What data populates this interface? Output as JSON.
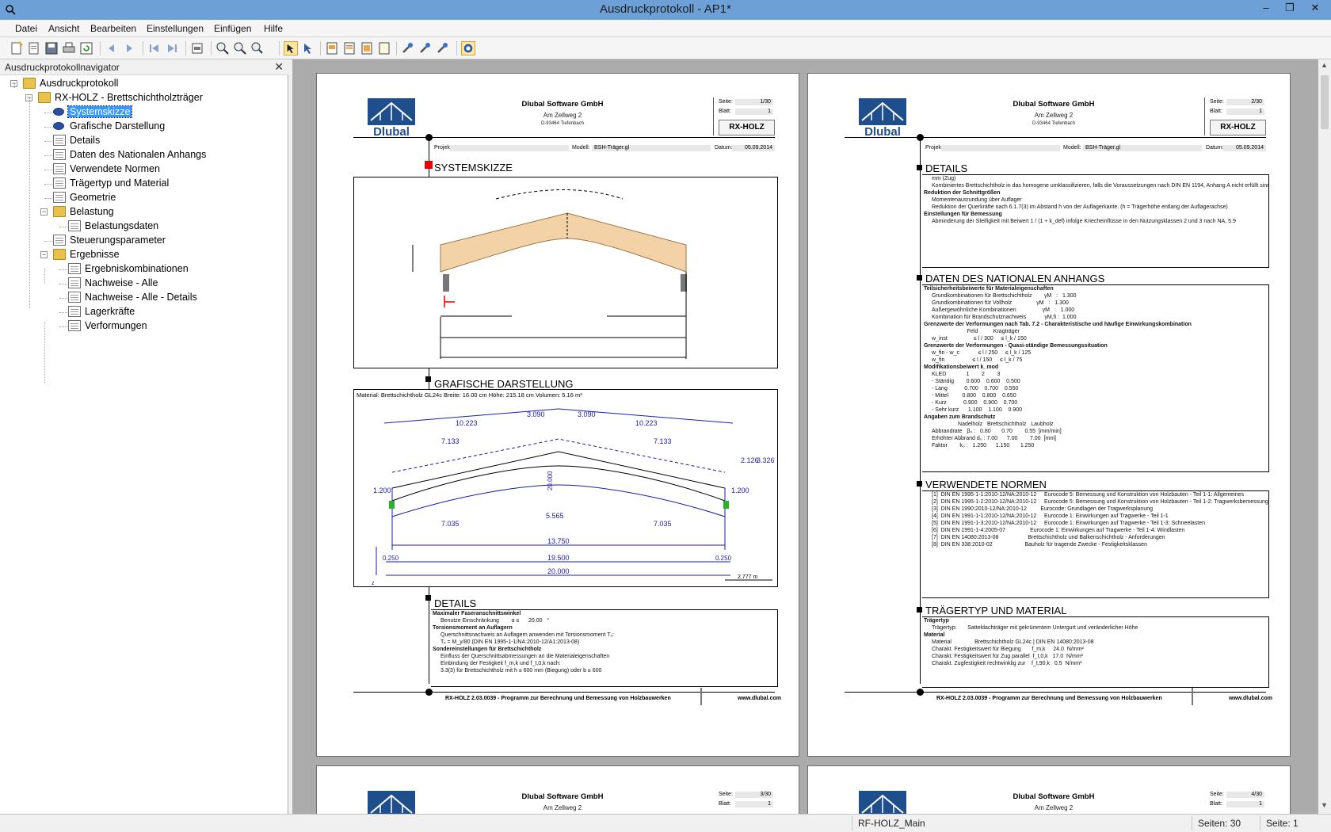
{
  "window": {
    "title": "Ausdruckprotokoll - AP1*",
    "controls": [
      "–",
      "❐",
      "✕"
    ]
  },
  "menu": [
    "Datei",
    "Ansicht",
    "Bearbeiten",
    "Einstellungen",
    "Einfügen",
    "Hilfe"
  ],
  "navigator": {
    "title": "Ausdruckprotokollnavigator",
    "tree": [
      {
        "label": "Ausdruckprotokoll",
        "level": 0,
        "icon": "folder",
        "exp": "-"
      },
      {
        "label": "RX-HOLZ - Brettschichtholzträger",
        "level": 1,
        "icon": "folder",
        "exp": "-"
      },
      {
        "label": "Systemskizze",
        "level": 2,
        "icon": "eye",
        "selected": true
      },
      {
        "label": "Grafische Darstellung",
        "level": 2,
        "icon": "eye"
      },
      {
        "label": "Details",
        "level": 2,
        "icon": "doc"
      },
      {
        "label": "Daten des Nationalen Anhangs",
        "level": 2,
        "icon": "doc"
      },
      {
        "label": "Verwendete Normen",
        "level": 2,
        "icon": "doc"
      },
      {
        "label": "Trägertyp und Material",
        "level": 2,
        "icon": "doc"
      },
      {
        "label": "Geometrie",
        "level": 2,
        "icon": "doc"
      },
      {
        "label": "Belastung",
        "level": 2,
        "icon": "folder",
        "exp": "-"
      },
      {
        "label": "Belastungsdaten",
        "level": 3,
        "icon": "doc"
      },
      {
        "label": "Steuerungsparameter",
        "level": 2,
        "icon": "doc"
      },
      {
        "label": "Ergebnisse",
        "level": 2,
        "icon": "folder",
        "exp": "-"
      },
      {
        "label": "Ergebniskombinationen",
        "level": 3,
        "icon": "doc"
      },
      {
        "label": "Nachweise - Alle",
        "level": 3,
        "icon": "doc"
      },
      {
        "label": "Nachweise - Alle - Details",
        "level": 3,
        "icon": "doc"
      },
      {
        "label": "Lagerkräfte",
        "level": 3,
        "icon": "doc"
      },
      {
        "label": "Verformungen",
        "level": 3,
        "icon": "doc"
      }
    ]
  },
  "page_header": {
    "company": "Dlubal Software GmbH",
    "street": "Am Zellweg 2",
    "city": "D-93464 Tiefenbach",
    "logo_text": "Dlubal",
    "seite_label": "Seite:",
    "blatt_label": "Blatt:",
    "module": "RX-HOLZ",
    "projekt_label": "Projekt:",
    "modell_label": "Modell:",
    "modell": "BSH-Träger.gl",
    "datum_label": "Datum:",
    "datum": "05.09.2014"
  },
  "pages": [
    {
      "seite": "1/30",
      "blatt": "1"
    },
    {
      "seite": "2/30",
      "blatt": "1"
    },
    {
      "seite": "3/30",
      "blatt": "1"
    },
    {
      "seite": "4/30",
      "blatt": "1"
    }
  ],
  "page1": {
    "sec_systemskizze": "SYSTEMSKIZZE",
    "sec_grafische": "GRAFISCHE DARSTELLUNG",
    "grafische_info": "Material: Brettschichtholz GL24c   Breite: 16.00 cm   Höhe: 215.18 cm   Volumen: 5.16 m³",
    "dims": [
      "10.223",
      "3.090",
      "3.090",
      "10.223",
      "7.133",
      "7.133",
      "1.200",
      "1.200",
      "2.126",
      "3.326",
      "7.035",
      "5.565",
      "7.035",
      "13.750",
      "19.500",
      "20.000",
      "0.250",
      "0.250",
      "20.000",
      "2.777 m"
    ],
    "sec_details": "DETAILS",
    "details_lines": [
      {
        "t": "Maximaler Faseranschnittswinkel",
        "h": true
      },
      {
        "t": "Benutze Einschränkung        α ≤      20.00   °"
      },
      {
        "t": "Torsionsmoment an Auflagern",
        "h": true
      },
      {
        "t": "Querschnittsnachweis an Auflagern anwenden mit Torsionsmoment Tₓ:"
      },
      {
        "t": "Tₓ = M_y/80 (DIN EN 1995-1-1/NA:2010-12/A1:2013-08)"
      },
      {
        "t": "Sondereinstellungen für Brettschichtholz",
        "h": true
      },
      {
        "t": "Einfluss der Querschnittsabmessungen an die Materialeigenschaften"
      },
      {
        "t": "Einbindung der Festigkeit f_m,k und f_t,0,k nach:"
      },
      {
        "t": "3.3(3) für Brettschichtholz mit h ≤ 600 mm (Biegung) oder b ≤ 600"
      }
    ],
    "footer": "RX-HOLZ 2.03.0039 - Programm zur Berechnung und Bemessung von Holzbauwerken",
    "footer_url": "www.dlubal.com"
  },
  "page2": {
    "sec_details": "DETAILS",
    "details_lines": [
      {
        "t": "mm (Zug)"
      },
      {
        "t": "Kombiniertes Brettschichtholz in das homogene umklassifizieren, falls die Voraussetzungen nach DIN EN 1194, Anhang A nicht erfüllt sind"
      },
      {
        "t": "Reduktion der Schnittgrößen",
        "h": true
      },
      {
        "t": "Momentenausrundung über Auflager"
      },
      {
        "t": "Reduktion der Querkräfte nach 6.1.7(3) im Abstand h von der Auflagerkante. (h = Trägerhöhe entlang der Auflagerachse)"
      },
      {
        "t": "Einstellungen für Bemessung",
        "h": true
      },
      {
        "t": "Abminderung der Steifigkeit mit Beiwert 1 / (1 + k_def) infolge Kriecheinflüsse in den Nutzungsklassen 2 und 3 nach NA, 5.9"
      }
    ],
    "sec_na": "DATEN DES NATIONALEN ANHANGS",
    "na_lines": [
      {
        "t": "Teilsicherheitsbeiwerte für Materialeigenschaften",
        "h": true
      },
      {
        "t": "Grundkombinationen für Brettschichtholz        γM   :   1.300"
      },
      {
        "t": "Grundkombinationen für Vollholz                γM   :   1.300"
      },
      {
        "t": "Außergewöhnliche Kombinationen                 γM   :   1.000"
      },
      {
        "t": "Kombination für Brandschutznachweis            γM,fi :  1.000"
      },
      {
        "t": "Grenzwerte der Verformungen nach Tab. 7.2 - Charakteristische und häufige Einwirkungskombination",
        "h": true
      },
      {
        "t": "                       Feld          Kragträger"
      },
      {
        "t": "w_inst                 ≤ l / 300     ≤ l_k / 150"
      },
      {
        "t": "Grenzwerte der Verformungen - Quasi-ständige Bemessungssituation",
        "h": true
      },
      {
        "t": "w_fin - w_c            ≤ l / 250     ≤ l_k / 125"
      },
      {
        "t": "w_fin                  ≤ l / 150     ≤ l_k / 75"
      },
      {
        "t": "Modifikationsbeiwert k_mod",
        "h": true
      },
      {
        "t": "KLED             1        2        3"
      },
      {
        "t": "- Ständig        0.600    0.600    0.500"
      },
      {
        "t": "- Lang           0.700    0.700    0.550"
      },
      {
        "t": "- Mittel         0.800    0.800    0.650"
      },
      {
        "t": "- Kurz           0.900    0.900    0.700"
      },
      {
        "t": "- Sehr kurz      1.100    1.100    0.900"
      },
      {
        "t": "Angaben zum Brandschutz",
        "h": true
      },
      {
        "t": "                 Nadelholz   Brettschichtholz   Laubholz"
      },
      {
        "t": "Abbrandrate   β₀ :   0.80       0.70        0.55  [mm/min]"
      },
      {
        "t": "Erhöhter Abbrand d₀ : 7.00      7.00        7.00  [mm]"
      },
      {
        "t": "Faktor        k₀ :   1.250      1.150       1.250"
      }
    ],
    "sec_normen": "VERWENDETE NORMEN",
    "normen_lines": [
      {
        "t": "[1]  DIN EN 1995-1-1:2010-12/NA:2010-12     Eurocode 5: Bemessung und Konstruktion von Holzbauten - Teil 1-1: Allgemeines"
      },
      {
        "t": "[2]  DIN EN 1995-1-2:2010-12/NA:2010-12     Eurocode 5: Bemessung und Konstruktion von Holzbauten - Teil 1-2: Tragwerksbemessung für den Brandfall"
      },
      {
        "t": "[3]  DIN EN 1990:2010-12/NA:2010-12         Eurocode: Grundlagen der Tragwerksplanung"
      },
      {
        "t": "[4]  DIN EN 1991-1-1:2010-12/NA:2010-12     Eurocode 1: Einwirkungen auf Tragwerke - Teil 1-1"
      },
      {
        "t": "[5]  DIN EN 1991-1-3:2010-12/NA:2010-12     Eurocode 1: Einwirkungen auf Tragwerke - Teil 1-3: Schneelasten"
      },
      {
        "t": "[6]  DIN EN 1991-1-4:2005-07                Eurocode 1: Einwirkungen auf Tragwerke - Teil 1-4: Windlasten"
      },
      {
        "t": "[7]  DIN EN 14080:2013-08                   Brettschichtholz und Balkenschichtholz - Anforderungen"
      },
      {
        "t": "[8]  DIN EN 338:2010-02                     Bauholz für tragende Zwecke - Festigkeitsklassen"
      }
    ],
    "sec_traeger": "TRÄGERTYP UND MATERIAL",
    "traeger_lines": [
      {
        "t": "Trägertyp",
        "h": true
      },
      {
        "t": "Trägertyp:       Satteldachträger mit gekrümmtem Untergurt und veränderlicher Höhe"
      },
      {
        "t": "Material",
        "h": true
      },
      {
        "t": "Material               Brettschichtholz GL24c | DIN EN 14080:2013-08"
      },
      {
        "t": "Charakt. Festigkeitswert für Biegung       f_m,k     24.0  N/mm²"
      },
      {
        "t": "Charakt. Festigkeitswert für Zug parallel  f_t,0,k   17.0  N/mm²"
      },
      {
        "t": "Charakt. Zugfestigkeit rechtwinklig zur    f_t,90,k   0.5  N/mm²"
      }
    ],
    "footer": "RX-HOLZ 2.03.0039 - Programm zur Berechnung und Bemessung von Holzbauwerken",
    "footer_url": "www.dlubal.com"
  },
  "status": {
    "model": "RF-HOLZ_Main",
    "seiten": "Seiten: 30",
    "seite": "Seite: 1"
  },
  "colors": {
    "titlebar": "#6ca0d6",
    "selection": "#3399ff",
    "beam": "#f2d2a6",
    "dim_blue": "#1c1ca8",
    "logo_blue": "#1f4e8c"
  }
}
